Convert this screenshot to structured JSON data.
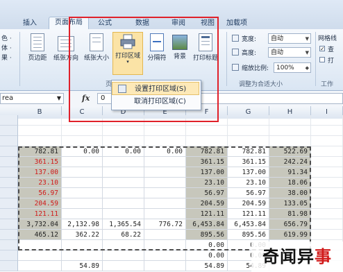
{
  "ribbon": {
    "tabs": [
      "插入",
      "页面布局",
      "公式",
      "数据",
      "审阅",
      "视图",
      "加载项"
    ],
    "active_tab": "页面布局",
    "left_fragment": "色 ·",
    "left_fragment2": "体 ·",
    "left_fragment3": "果 ·",
    "buttons": [
      {
        "label": "页边距",
        "icon": "margins-icon"
      },
      {
        "label": "纸张方向",
        "icon": "orientation-icon"
      },
      {
        "label": "纸张大小",
        "icon": "paper-size-icon"
      },
      {
        "label": "打印区域",
        "icon": "print-area-icon"
      },
      {
        "label": "分隔符",
        "icon": "breaks-icon"
      },
      {
        "label": "背景",
        "icon": "background-icon"
      },
      {
        "label": "打印标题",
        "icon": "print-titles-icon"
      }
    ],
    "group_page_setup_fragment": "页",
    "scale": {
      "width_label": "宽度:",
      "width_value": "自动",
      "height_label": "高度:",
      "height_value": "自动",
      "zoom_label": "缩放比例:",
      "zoom_value": "100%",
      "group_label": "调整为合适大小"
    },
    "sheet_options": {
      "gridlines_label": "网格线",
      "view_fragment": "查",
      "print_fragment": "打",
      "group_label": "工作"
    }
  },
  "dropdown_menu": {
    "items": [
      {
        "label": "设置打印区域(S)",
        "icon": "set-print-area-icon"
      },
      {
        "label": "取消打印区域(C)",
        "icon": ""
      }
    ]
  },
  "formula_bar": {
    "name_box": "rea",
    "fx": "fx",
    "value": "0"
  },
  "columns": [
    "B",
    "C",
    "D",
    "E",
    "F",
    "G",
    "H",
    "I"
  ],
  "rows": [
    {
      "cells": [
        "782.81",
        "0.00",
        "0.00",
        "0.00",
        "782.81",
        "782.81",
        "522.69"
      ],
      "red": [
        false,
        false,
        false,
        false,
        false,
        false,
        false
      ]
    },
    {
      "cells": [
        "361.15",
        "",
        "",
        "",
        "361.15",
        "361.15",
        "242.24"
      ],
      "red": [
        true,
        false,
        false,
        false,
        false,
        false,
        false
      ]
    },
    {
      "cells": [
        "137.00",
        "",
        "",
        "",
        "137.00",
        "137.00",
        "91.34"
      ],
      "red": [
        true,
        false,
        false,
        false,
        false,
        false,
        false
      ]
    },
    {
      "cells": [
        "23.10",
        "",
        "",
        "",
        "23.10",
        "23.10",
        "18.06"
      ],
      "red": [
        true,
        false,
        false,
        false,
        false,
        false,
        false
      ]
    },
    {
      "cells": [
        "56.97",
        "",
        "",
        "",
        "56.97",
        "56.97",
        "38.00"
      ],
      "red": [
        true,
        false,
        false,
        false,
        false,
        false,
        false
      ]
    },
    {
      "cells": [
        "204.59",
        "",
        "",
        "",
        "204.59",
        "204.59",
        "133.05"
      ],
      "red": [
        true,
        false,
        false,
        false,
        false,
        false,
        false
      ]
    },
    {
      "cells": [
        "121.11",
        "",
        "",
        "",
        "121.11",
        "121.11",
        "81.98"
      ],
      "red": [
        true,
        false,
        false,
        false,
        false,
        false,
        false
      ]
    },
    {
      "cells": [
        "3,732.04",
        "2,132.98",
        "1,365.54",
        "776.72",
        "6,453.84",
        "6,453.84",
        "656.79"
      ],
      "red": [
        false,
        false,
        false,
        false,
        false,
        false,
        false
      ]
    },
    {
      "cells": [
        "465.12",
        "362.22",
        "68.22",
        "",
        "895.56",
        "895.56",
        "619.99"
      ],
      "red": [
        false,
        false,
        false,
        false,
        false,
        false,
        false
      ]
    },
    {
      "cells": [
        "",
        "",
        "",
        "",
        "0.00",
        "0.00",
        ""
      ],
      "red": [
        false,
        false,
        false,
        false,
        false,
        false,
        false
      ]
    },
    {
      "cells": [
        "",
        "",
        "",
        "",
        "0.00",
        "0.00",
        ""
      ],
      "red": [
        false,
        false,
        false,
        false,
        false,
        false,
        false
      ]
    },
    {
      "cells": [
        "",
        "54.89",
        "",
        "",
        "54.89",
        "54.89",
        ""
      ],
      "red": [
        false,
        false,
        false,
        false,
        false,
        false,
        false
      ]
    }
  ],
  "watermark": {
    "text_main": "奇闻异",
    "text_accent": "事"
  }
}
